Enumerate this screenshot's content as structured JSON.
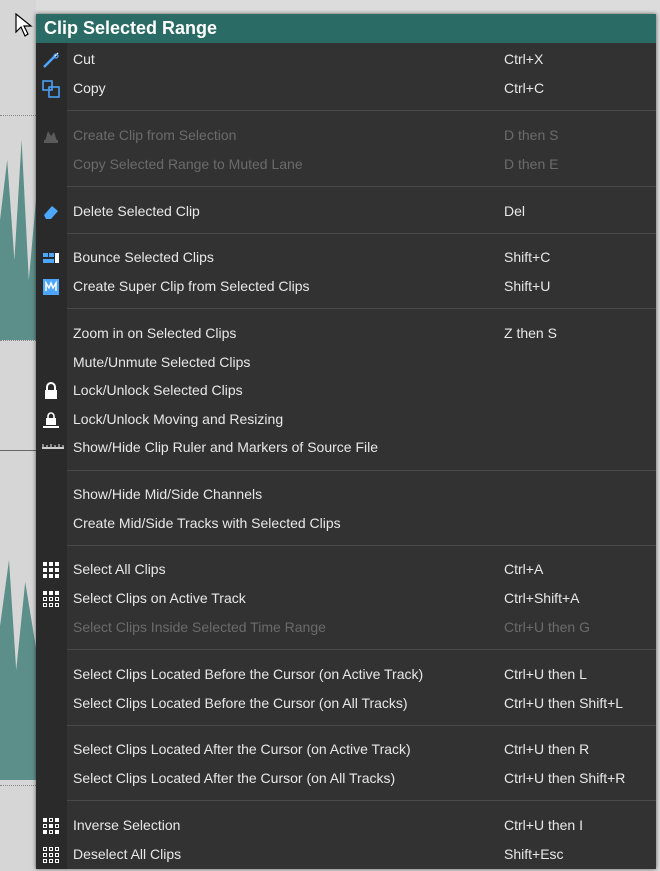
{
  "menu": {
    "title": "Clip Selected Range",
    "items": [
      {
        "label": "Cut",
        "shortcut": "Ctrl+X",
        "icon": "scissors-icon",
        "enabled": true
      },
      {
        "label": "Copy",
        "shortcut": "Ctrl+C",
        "icon": "copy-icon",
        "enabled": true
      },
      {
        "label": "Create Clip from Selection",
        "shortcut": "D then S",
        "icon": "create-clip-icon",
        "enabled": false
      },
      {
        "label": "Copy Selected Range to Muted Lane",
        "shortcut": "D then E",
        "icon": "",
        "enabled": false
      },
      {
        "label": "Delete Selected Clip",
        "shortcut": "Del",
        "icon": "eraser-icon",
        "enabled": true
      },
      {
        "label": "Bounce Selected Clips",
        "shortcut": "Shift+C",
        "icon": "bounce-icon",
        "enabled": true
      },
      {
        "label": "Create Super Clip from Selected Clips",
        "shortcut": "Shift+U",
        "icon": "super-clip-icon",
        "enabled": true
      },
      {
        "label": "Zoom in on Selected Clips",
        "shortcut": "Z then S",
        "icon": "",
        "enabled": true
      },
      {
        "label": "Mute/Unmute Selected Clips",
        "shortcut": "",
        "icon": "",
        "enabled": true
      },
      {
        "label": "Lock/Unlock Selected Clips",
        "shortcut": "",
        "icon": "lock-icon",
        "enabled": true
      },
      {
        "label": "Lock/Unlock Moving and Resizing",
        "shortcut": "",
        "icon": "lock-move-icon",
        "enabled": true
      },
      {
        "label": "Show/Hide Clip Ruler and Markers of Source File",
        "shortcut": "",
        "icon": "ruler-icon",
        "enabled": true
      },
      {
        "label": "Show/Hide Mid/Side Channels",
        "shortcut": "",
        "icon": "",
        "enabled": true
      },
      {
        "label": "Create Mid/Side Tracks with Selected Clips",
        "shortcut": "",
        "icon": "",
        "enabled": true
      },
      {
        "label": "Select All Clips",
        "shortcut": "Ctrl+A",
        "icon": "grid-icon",
        "enabled": true
      },
      {
        "label": "Select Clips on Active Track",
        "shortcut": "Ctrl+Shift+A",
        "icon": "grid-row-icon",
        "enabled": true
      },
      {
        "label": "Select Clips Inside Selected Time Range",
        "shortcut": "Ctrl+U then G",
        "icon": "",
        "enabled": false
      },
      {
        "label": "Select Clips Located Before the Cursor (on Active Track)",
        "shortcut": "Ctrl+U then L",
        "icon": "",
        "enabled": true
      },
      {
        "label": "Select Clips Located Before the Cursor (on All Tracks)",
        "shortcut": "Ctrl+U then Shift+L",
        "icon": "",
        "enabled": true
      },
      {
        "label": "Select Clips Located After the Cursor (on Active Track)",
        "shortcut": "Ctrl+U then R",
        "icon": "",
        "enabled": true
      },
      {
        "label": "Select Clips Located After the Cursor (on All Tracks)",
        "shortcut": "Ctrl+U then Shift+R",
        "icon": "",
        "enabled": true
      },
      {
        "label": "Inverse Selection",
        "shortcut": "Ctrl+U then I",
        "icon": "inverse-grid-icon",
        "enabled": true
      },
      {
        "label": "Deselect All Clips",
        "shortcut": "Shift+Esc",
        "icon": "deselect-grid-icon",
        "enabled": true
      }
    ]
  },
  "colors": {
    "title_bar": "#2b6b66",
    "menu_bg": "#323232",
    "text": "#e8e8e8",
    "disabled_text": "#6b6b6b",
    "icon_accent": "#4da6ff"
  }
}
